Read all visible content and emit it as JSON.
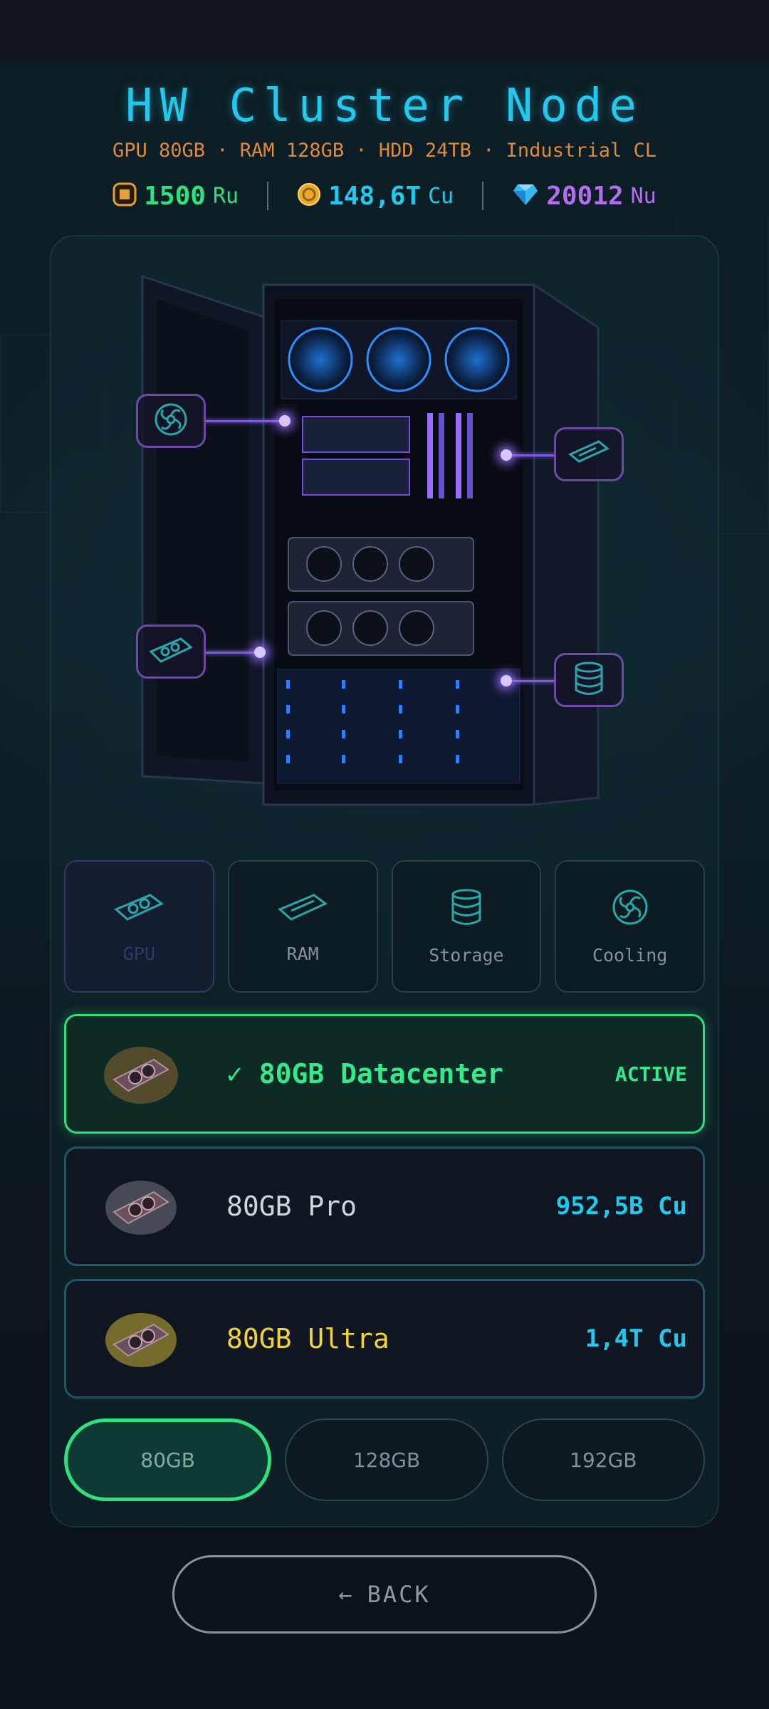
{
  "header": {
    "title": "HW Cluster Node",
    "subtitle": "GPU 80GB · RAM 128GB · HDD 24TB · Industrial CL"
  },
  "currencies": [
    {
      "value": "1500",
      "unit": "Ru",
      "icon": "chip-coin-icon",
      "color": "#2ee07e"
    },
    {
      "value": "148,6T",
      "unit": "Cu",
      "icon": "gold-coin-icon",
      "color": "#22c9ee"
    },
    {
      "value": "20012",
      "unit": "Nu",
      "icon": "diamond-icon",
      "color": "#b46cf0"
    }
  ],
  "hotspots": [
    {
      "icon": "fan-icon"
    },
    {
      "icon": "ram-stick-icon"
    },
    {
      "icon": "gpu-card-icon"
    },
    {
      "icon": "storage-stack-icon"
    }
  ],
  "categories": [
    {
      "label": "GPU",
      "icon": "gpu-card-icon",
      "selected": true
    },
    {
      "label": "RAM",
      "icon": "ram-stick-icon",
      "selected": false
    },
    {
      "label": "Storage",
      "icon": "storage-stack-icon",
      "selected": false
    },
    {
      "label": "Cooling",
      "icon": "fan-icon",
      "selected": false
    }
  ],
  "items": [
    {
      "name": "✓ 80GB Datacenter",
      "price": "ACTIVE",
      "active": true,
      "glow": "#d8893a"
    },
    {
      "name": "80GB Pro",
      "price": "952,5B Cu",
      "active": false,
      "name_color": "#cfd6da",
      "glow": "#e8e8f0"
    },
    {
      "name": "80GB Ultra",
      "price": "1,4T Cu",
      "active": false,
      "name_color": "#f2d33a",
      "glow": "#f2d33a"
    }
  ],
  "sizes": [
    {
      "label": "80GB",
      "selected": true
    },
    {
      "label": "128GB",
      "selected": false
    },
    {
      "label": "192GB",
      "selected": false
    }
  ],
  "back": {
    "label": "BACK",
    "arrow": "←"
  },
  "colors": {
    "accent": "#22c9ee",
    "active": "#2ee07e",
    "hotspot": "#6c4aa6"
  }
}
